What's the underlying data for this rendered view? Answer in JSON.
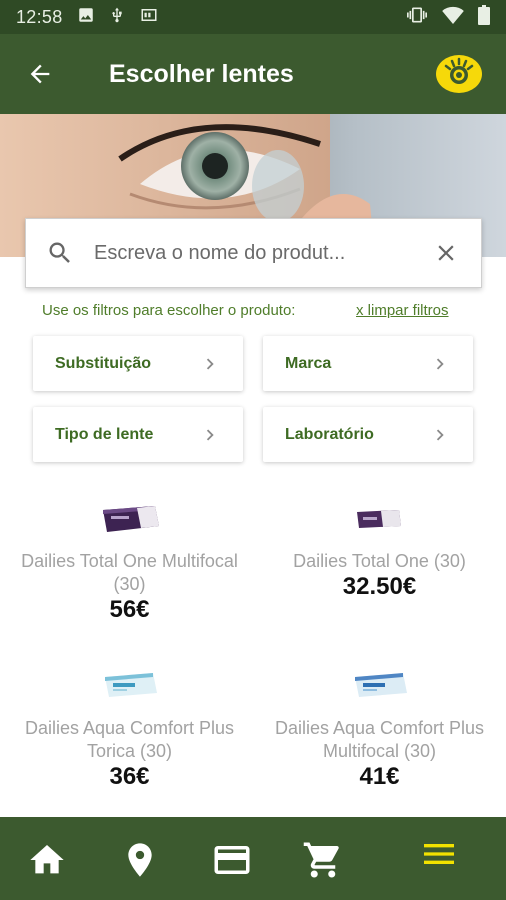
{
  "status_bar": {
    "time": "12:58",
    "icons_left": [
      "image-icon",
      "usb-icon",
      "cast-icon"
    ],
    "icons_right": [
      "vibrate-icon",
      "wifi-icon",
      "battery-icon"
    ]
  },
  "app_bar": {
    "title": "Escolher lentes",
    "back_icon": "arrow-left-icon",
    "logo": "eye-logo-icon"
  },
  "search": {
    "placeholder": "Escreva o nome do produt...",
    "value": ""
  },
  "filters": {
    "hint": "Use os filtros para escolher o produto:",
    "clear_label": "x limpar filtros",
    "buttons": [
      {
        "label": "Substituição"
      },
      {
        "label": "Marca"
      },
      {
        "label": "Tipo de lente"
      },
      {
        "label": "Laboratório"
      }
    ]
  },
  "products": [
    {
      "name": "Dailies Total One  Multifocal (30)",
      "price": "56€"
    },
    {
      "name": "Dailies Total One  (30)",
      "price": "32.50€"
    },
    {
      "name": "Dailies Aqua Comfort Plus Torica (30)",
      "price": "36€"
    },
    {
      "name": "Dailies Aqua Comfort Plus Multifocal (30)",
      "price": "41€"
    }
  ],
  "bottom_nav": {
    "items": [
      "home-icon",
      "location-pin-icon",
      "credit-card-icon",
      "cart-icon",
      "menu-icon"
    ],
    "active": "menu-icon",
    "colors": {
      "default": "#ffffff",
      "active": "#f2e200"
    }
  },
  "colors": {
    "primary": "#3c5a2f",
    "status_bar": "#2f4a25",
    "accent_text": "#4f7d2a",
    "logo_yellow": "#f6d90a"
  }
}
